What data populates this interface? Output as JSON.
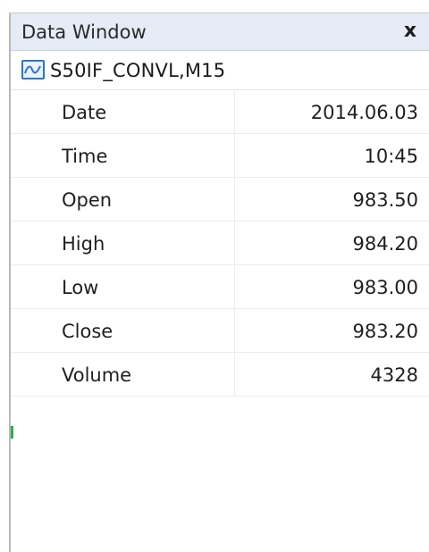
{
  "window": {
    "title": "Data Window",
    "close_label": "x"
  },
  "symbol": {
    "icon": "line-chart-icon",
    "name": "S50IF_CONVL,M15"
  },
  "rows": [
    {
      "label": "Date",
      "value": "2014.06.03"
    },
    {
      "label": "Time",
      "value": "10:45"
    },
    {
      "label": "Open",
      "value": "983.50"
    },
    {
      "label": "High",
      "value": "984.20"
    },
    {
      "label": "Low",
      "value": "983.00"
    },
    {
      "label": "Close",
      "value": "983.20"
    },
    {
      "label": "Volume",
      "value": "4328"
    }
  ],
  "colors": {
    "titlebar": "#e5ecf5",
    "icon_accent": "#2f74c9"
  }
}
